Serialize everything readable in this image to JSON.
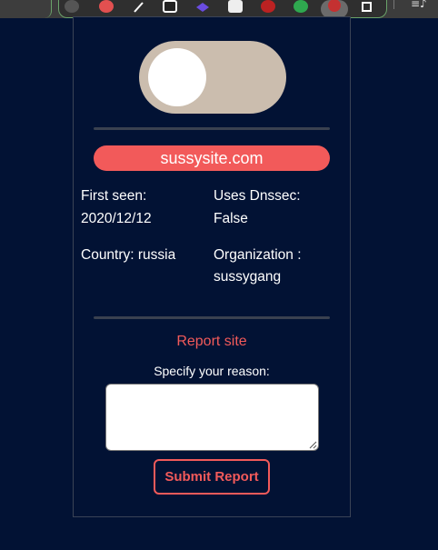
{
  "toggle": {
    "state": "off"
  },
  "site": {
    "domain": "sussysite.com"
  },
  "info": {
    "first_seen_label": "First seen:",
    "first_seen_value": "2020/12/12",
    "dnssec_label": "Uses Dnssec:",
    "dnssec_value": "False",
    "country_label": "Country: russia",
    "organization_label": "Organization :",
    "organization_value": "sussygang"
  },
  "report": {
    "title": "Report site",
    "reason_label": "Specify your reason:",
    "reason_value": "",
    "submit_label": "Submit Report"
  },
  "colors": {
    "background": "#021234",
    "accent": "#f25a5a",
    "toggle_track": "#cbbdae"
  },
  "toolbar": {
    "icons": [
      "extension-icon-1",
      "extension-icon-2",
      "extension-icon-3",
      "extension-icon-4",
      "extension-icon-5",
      "extension-icon-6",
      "extension-icon-7",
      "extension-icon-8",
      "active-extension-icon",
      "puzzle-icon",
      "media-icon"
    ]
  }
}
